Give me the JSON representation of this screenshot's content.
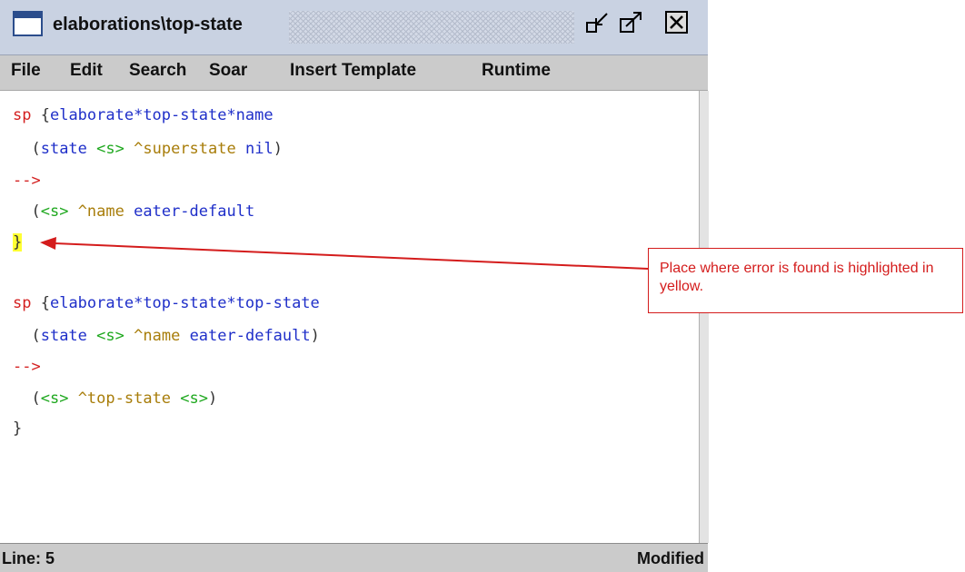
{
  "window": {
    "title": "elaborations\\top-state"
  },
  "menu": [
    {
      "label": "File"
    },
    {
      "label": "Edit"
    },
    {
      "label": "Search"
    },
    {
      "label": "Soar"
    },
    {
      "label": "Insert Template"
    },
    {
      "label": "Runtime"
    }
  ],
  "code": {
    "line1": {
      "kw": "sp",
      "rest_a": " {",
      "name": "elaborate*top-state*name"
    },
    "line2": {
      "pre": "  (",
      "word": "state",
      "space1": " ",
      "var": "<s>",
      "space2": " ",
      "attr": "^superstate",
      "space3": " ",
      "val": "nil",
      "post": ")"
    },
    "line3": {
      "arrow": "-->"
    },
    "line4": {
      "pre": "  (",
      "var": "<s>",
      "space1": " ",
      "attr": "^name",
      "space2": " ",
      "val": "eater-default"
    },
    "line5": {
      "brace": "}"
    },
    "line7": {
      "kw": "sp",
      "rest_a": " {",
      "name": "elaborate*top-state*top-state"
    },
    "line8": {
      "pre": "  (",
      "word": "state",
      "space1": " ",
      "var": "<s>",
      "space2": " ",
      "attr": "^name",
      "space3": " ",
      "val": "eater-default",
      "post": ")"
    },
    "line9": {
      "arrow": "-->"
    },
    "line10": {
      "pre": "  (",
      "var": "<s>",
      "space1": " ",
      "attr": "^top-state",
      "space2": " ",
      "var2": "<s>",
      "post": ")"
    },
    "line11": {
      "brace": "}"
    }
  },
  "status": {
    "line": "Line: 5",
    "modified": "Modified"
  },
  "annotation": {
    "text": "Place where error is found is highlighted in yellow."
  },
  "colors": {
    "keyword": "#d42020",
    "production_name": "#1f2fc9",
    "variable": "#1fa81f",
    "attribute": "#a87d0a",
    "highlight": "#ffff33",
    "annotation": "#d41c1c"
  }
}
